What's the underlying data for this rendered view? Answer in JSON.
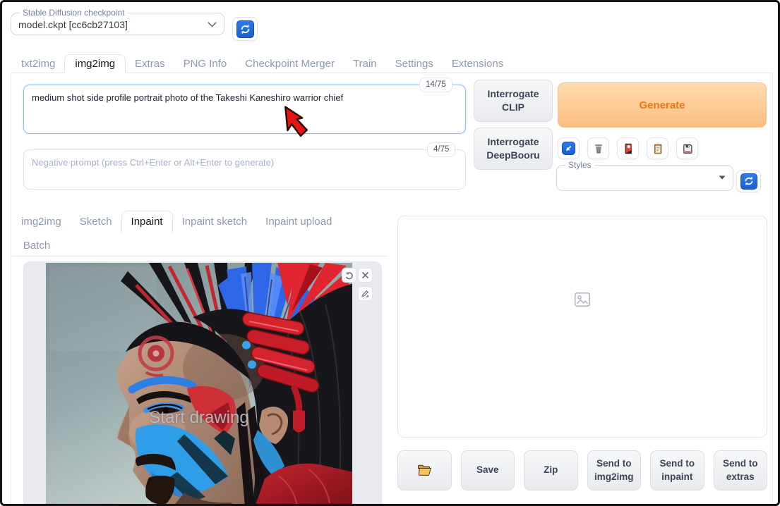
{
  "checkpoint": {
    "label": "Stable Diffusion checkpoint",
    "value": "model.ckpt [cc6cb27103]",
    "refresh_icon": "refresh-icon"
  },
  "main_tabs": {
    "active": "img2img",
    "items": [
      {
        "label": "txt2img"
      },
      {
        "label": "img2img"
      },
      {
        "label": "Extras"
      },
      {
        "label": "PNG Info"
      },
      {
        "label": "Checkpoint Merger"
      },
      {
        "label": "Train"
      },
      {
        "label": "Settings"
      },
      {
        "label": "Extensions"
      }
    ]
  },
  "prompt": {
    "value": "medium shot side profile portrait photo of the Takeshi Kaneshiro warrior chief",
    "counter": "14/75"
  },
  "negative_prompt": {
    "value": "",
    "placeholder": "Negative prompt (press Ctrl+Enter or Alt+Enter to generate)",
    "counter": "4/75"
  },
  "actions": {
    "interrogate_clip": "Interrogate CLIP",
    "interrogate_deepbooru": "Interrogate DeepBooru",
    "generate": "Generate",
    "toolbar_icons": [
      {
        "icon": "arrow-down-left-icon"
      },
      {
        "icon": "trash-icon"
      },
      {
        "icon": "flower-card-icon"
      },
      {
        "icon": "clipboard-icon"
      },
      {
        "icon": "floppy-disk-icon"
      }
    ]
  },
  "styles": {
    "label": "Styles",
    "value": "",
    "refresh_icon": "refresh-icon"
  },
  "img2img_tabs": {
    "active": "Inpaint",
    "items": [
      {
        "label": "img2img"
      },
      {
        "label": "Sketch"
      },
      {
        "label": "Inpaint"
      },
      {
        "label": "Inpaint sketch"
      },
      {
        "label": "Inpaint upload"
      },
      {
        "label": "Batch"
      }
    ]
  },
  "canvas": {
    "overlay_text": "Start drawing",
    "tools": [
      {
        "icon": "undo-icon"
      },
      {
        "icon": "close-icon"
      },
      {
        "icon": "draw-brush-icon"
      }
    ]
  },
  "output": {
    "placeholder_icon": "image-placeholder-icon",
    "folder_icon": "open-folder-icon",
    "buttons": {
      "save": "Save",
      "zip": "Zip",
      "send_img2img": "Send to img2img",
      "send_inpaint": "Send to inpaint",
      "send_extras": "Send to extras"
    }
  },
  "colors": {
    "generate_text": "#ee7711",
    "generate_bg_top": "#ffdcb0",
    "generate_bg_bottom": "#fbbd80",
    "focus_border": "#8ab9f7",
    "icon_blue": "#2b7bf0",
    "tab_inactive": "#8e99ab",
    "tab_active": "#16181d",
    "cursor_arrow": "#e81313"
  }
}
